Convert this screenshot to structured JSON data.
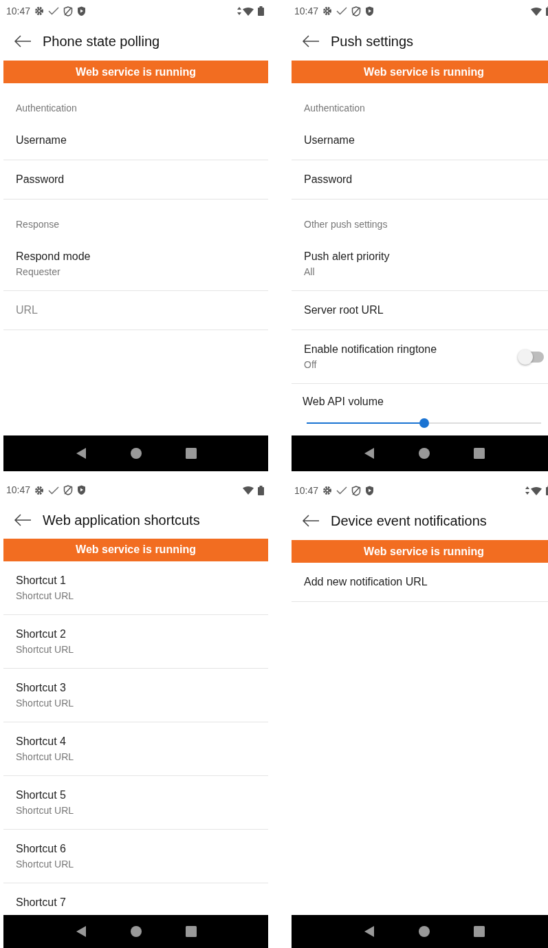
{
  "screens": [
    {
      "time": "10:47",
      "data_arrows": true,
      "title": "Phone state polling",
      "banner": "Web service is running",
      "items": [
        {
          "kind": "header",
          "title": "Authentication"
        },
        {
          "kind": "item",
          "title": "Username",
          "disabled": false
        },
        {
          "kind": "item",
          "title": "Password",
          "disabled": false
        },
        {
          "kind": "header",
          "title": "Response"
        },
        {
          "kind": "item",
          "title": "Respond mode",
          "summary": "Requester",
          "disabled": false
        },
        {
          "kind": "item",
          "title": "URL",
          "disabled": true
        }
      ]
    },
    {
      "time": "10:47",
      "data_arrows": false,
      "title": "Push settings",
      "banner": "Web service is running",
      "items": [
        {
          "kind": "header",
          "title": "Authentication"
        },
        {
          "kind": "item",
          "title": "Username",
          "disabled": false
        },
        {
          "kind": "item",
          "title": "Password",
          "disabled": false
        },
        {
          "kind": "header",
          "title": "Other push settings"
        },
        {
          "kind": "item",
          "title": "Push alert priority",
          "summary": "All",
          "disabled": false
        },
        {
          "kind": "item",
          "title": "Server root URL",
          "disabled": false
        },
        {
          "kind": "toggle",
          "title": "Enable notification ringtone",
          "summary": "Off",
          "on": false
        },
        {
          "kind": "slider",
          "title": "Web API volume",
          "level": 0.5
        }
      ]
    },
    {
      "time": "10:47",
      "data_arrows": false,
      "title": "Web application shortcuts",
      "banner": "Web service is running",
      "items": [
        {
          "kind": "item",
          "title": "Shortcut 1",
          "summary": "Shortcut URL",
          "disabled": false
        },
        {
          "kind": "item",
          "title": "Shortcut 2",
          "summary": "Shortcut URL",
          "disabled": false
        },
        {
          "kind": "item",
          "title": "Shortcut 3",
          "summary": "Shortcut URL",
          "disabled": false
        },
        {
          "kind": "item",
          "title": "Shortcut 4",
          "summary": "Shortcut URL",
          "disabled": false
        },
        {
          "kind": "item",
          "title": "Shortcut 5",
          "summary": "Shortcut URL",
          "disabled": false
        },
        {
          "kind": "item",
          "title": "Shortcut 6",
          "summary": "Shortcut URL",
          "disabled": false
        },
        {
          "kind": "item",
          "title": "Shortcut 7",
          "disabled": false
        }
      ]
    },
    {
      "time": "10:47",
      "data_arrows": true,
      "title": "Device event notifications",
      "banner": "Web service is running",
      "items": [
        {
          "kind": "item",
          "title": "Add new notification URL",
          "disabled": false
        }
      ]
    }
  ]
}
